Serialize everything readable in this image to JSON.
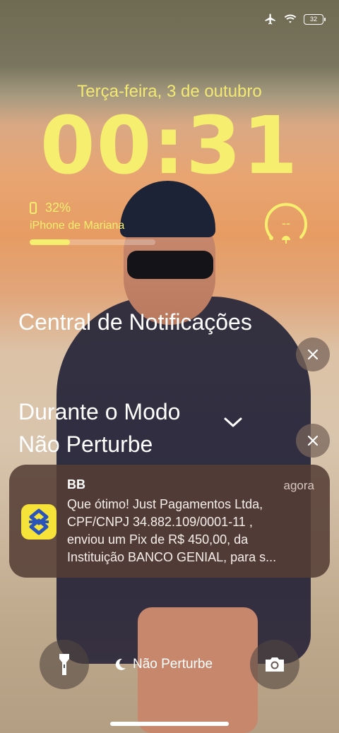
{
  "status_bar": {
    "battery": "32"
  },
  "lock": {
    "date": "Terça-feira, 3 de outubro",
    "time": "00:31"
  },
  "battery_widget": {
    "percent_label": "32%",
    "device": "iPhone de Mariana",
    "level": 0.32
  },
  "ring_widget": {
    "value": "--"
  },
  "notification_center": {
    "title": "Central de Notificações"
  },
  "focus_group": {
    "title": "Durante o Modo\nNão Perturbe"
  },
  "notification": {
    "app": "BB",
    "time": "agora",
    "body": "Que ótimo! Just Pagamentos Ltda,\nCPF/CNPJ 34.882.109/0001-11 ,\nenviou um Pix de R$  450,00, da\nInstituição BANCO GENIAL, para s..."
  },
  "bottom": {
    "focus_label": "Não Perturbe"
  },
  "colors": {
    "accent": "#f5ee6e",
    "notification_bg": "#553e36"
  },
  "icons": [
    "airplane-icon",
    "wifi-icon",
    "battery-icon",
    "phone-icon",
    "close-icon",
    "chevron-down-icon",
    "bb-logo-icon",
    "flashlight-icon",
    "moon-icon",
    "camera-icon"
  ]
}
